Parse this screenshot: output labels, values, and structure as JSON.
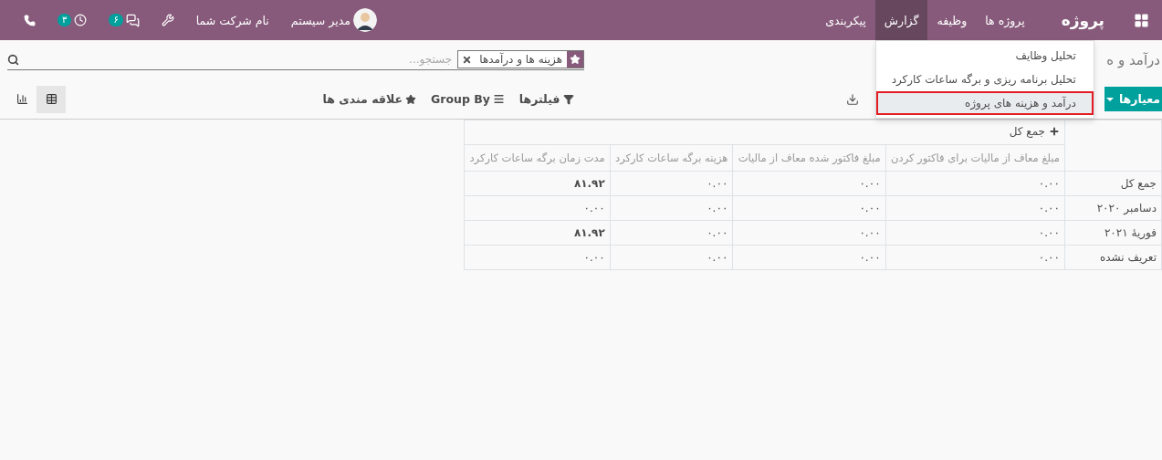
{
  "navbar": {
    "brand": "پروژه",
    "menu": [
      {
        "label": "پروژه ها",
        "selected": false
      },
      {
        "label": "وظیفه",
        "selected": false
      },
      {
        "label": "گزارش",
        "selected": true
      },
      {
        "label": "پیکربندی",
        "selected": false
      }
    ],
    "activity_badge": "۳",
    "messages_badge": "۶",
    "company": "نام شرکت شما",
    "user": "مدیر سیستم"
  },
  "report_menu": {
    "items": [
      {
        "label": "تحلیل وظایف",
        "selected": false
      },
      {
        "label": "تحلیل برنامه ریزی و برگه ساعات کارکرد",
        "selected": false
      },
      {
        "label": "درآمد و هزینه های پروژه",
        "selected": true
      }
    ]
  },
  "breadcrumb": "درآمد و ه",
  "search": {
    "facet": "هزینه ها و درآمدها",
    "placeholder": "جستجو..."
  },
  "toolbar": {
    "measures": "معیارها",
    "filters": "فیلترها",
    "group_by": "Group By",
    "favorites": "علاقه مندی ها",
    "views": [
      {
        "kind": "pivot",
        "selected": true
      },
      {
        "kind": "graph",
        "selected": false
      }
    ]
  },
  "pivot": {
    "column_header": "جمع کل",
    "measures": [
      "مبلغ معاف از مالیات برای فاکتور کردن",
      "مبلغ فاکتور شده معاف از مالیات",
      "هزینه برگه ساعات کارکرد",
      "مدت زمان برگه ساعات کارکرد"
    ],
    "rows": [
      {
        "label": "جمع کل",
        "cells": [
          {
            "value": "۰.۰۰",
            "bold": false
          },
          {
            "value": "۰.۰۰",
            "bold": false
          },
          {
            "value": "۰.۰۰",
            "bold": false
          },
          {
            "value": "۸۱.۹۲",
            "bold": true
          }
        ]
      },
      {
        "label": "دسامبر ۲۰۲۰",
        "cells": [
          {
            "value": "۰.۰۰",
            "bold": false
          },
          {
            "value": "۰.۰۰",
            "bold": false
          },
          {
            "value": "۰.۰۰",
            "bold": false
          },
          {
            "value": "۰.۰۰",
            "bold": false
          }
        ]
      },
      {
        "label": "فوریهٔ ۲۰۲۱",
        "cells": [
          {
            "value": "۰.۰۰",
            "bold": false
          },
          {
            "value": "۰.۰۰",
            "bold": false
          },
          {
            "value": "۰.۰۰",
            "bold": false
          },
          {
            "value": "۸۱.۹۲",
            "bold": true
          }
        ]
      },
      {
        "label": "تعریف نشده",
        "cells": [
          {
            "value": "۰.۰۰",
            "bold": false
          },
          {
            "value": "۰.۰۰",
            "bold": false
          },
          {
            "value": "۰.۰۰",
            "bold": false
          },
          {
            "value": "۰.۰۰",
            "bold": false
          }
        ]
      }
    ]
  }
}
